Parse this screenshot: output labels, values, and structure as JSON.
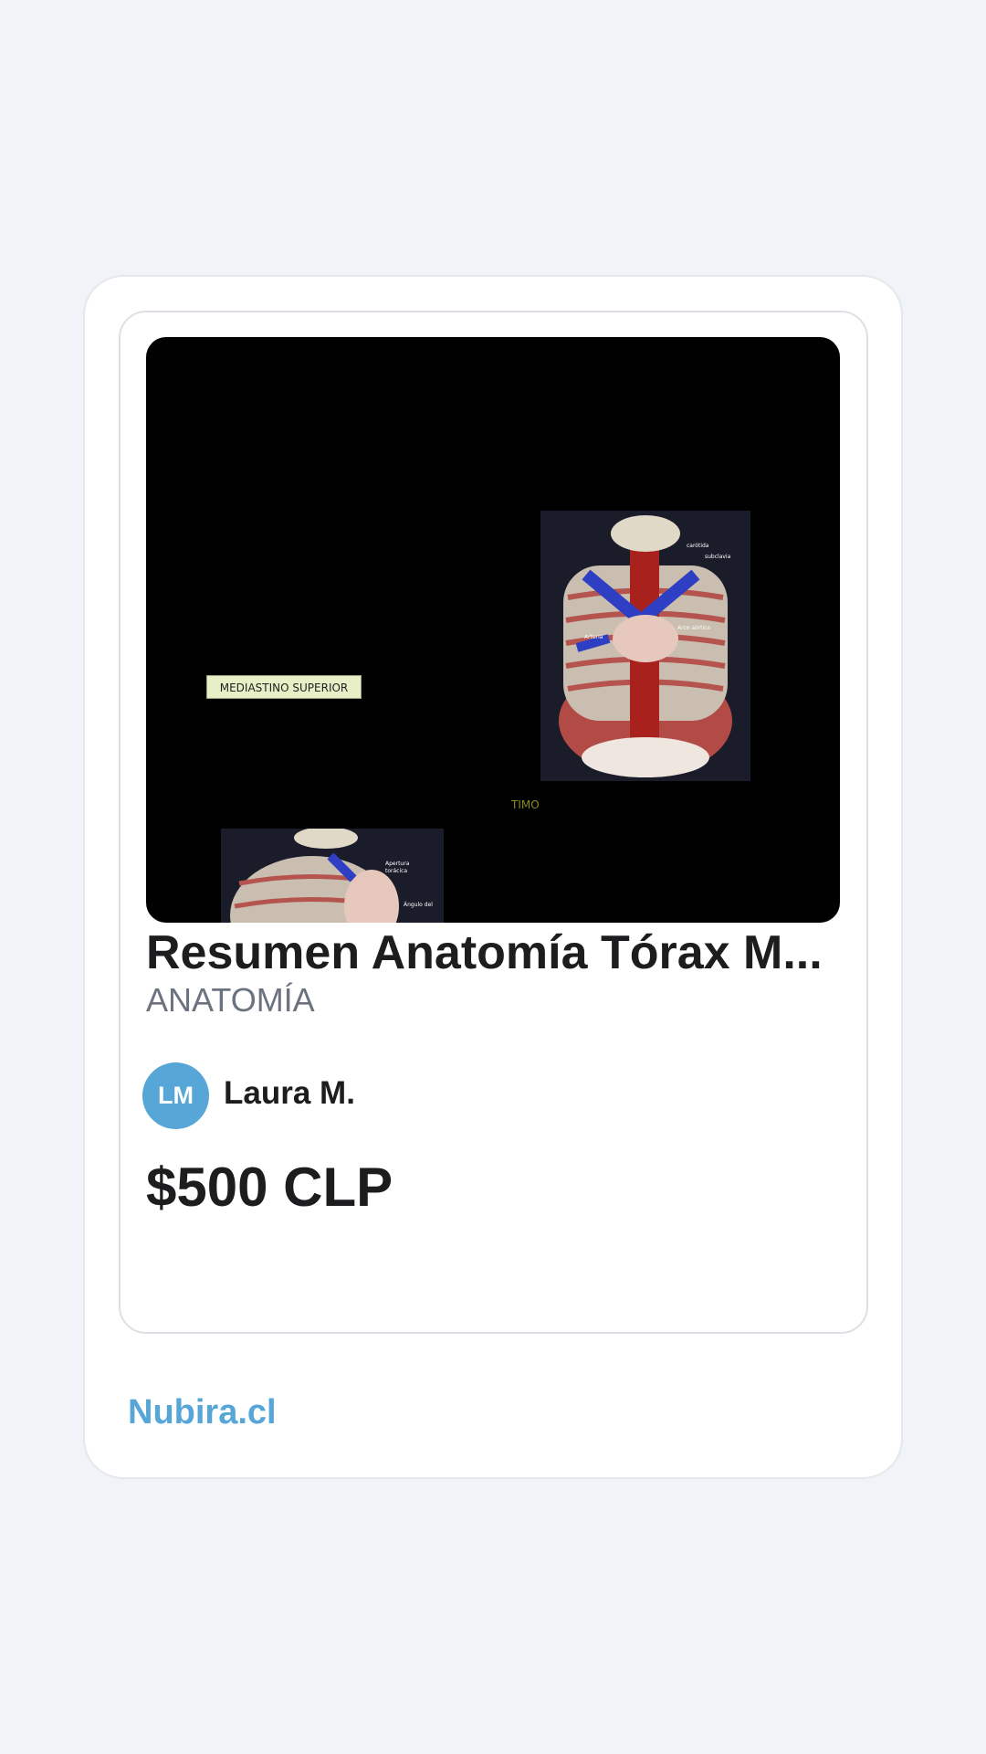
{
  "card": {
    "thumbnail": {
      "slide_label": "MEDIASTINO SUPERIOR",
      "slide_tag": "TIMO"
    },
    "title": "Resumen Anatomía Tórax M...",
    "category": "ANATOMÍA",
    "author": {
      "initials": "LM",
      "name": "Laura M."
    },
    "price": "$500 CLP"
  },
  "footer": {
    "brand": "Nubira.cl"
  },
  "colors": {
    "accent": "#57a6d8",
    "background": "#f0f4f8",
    "text": "#1d1d1f",
    "muted": "#6b7280"
  }
}
